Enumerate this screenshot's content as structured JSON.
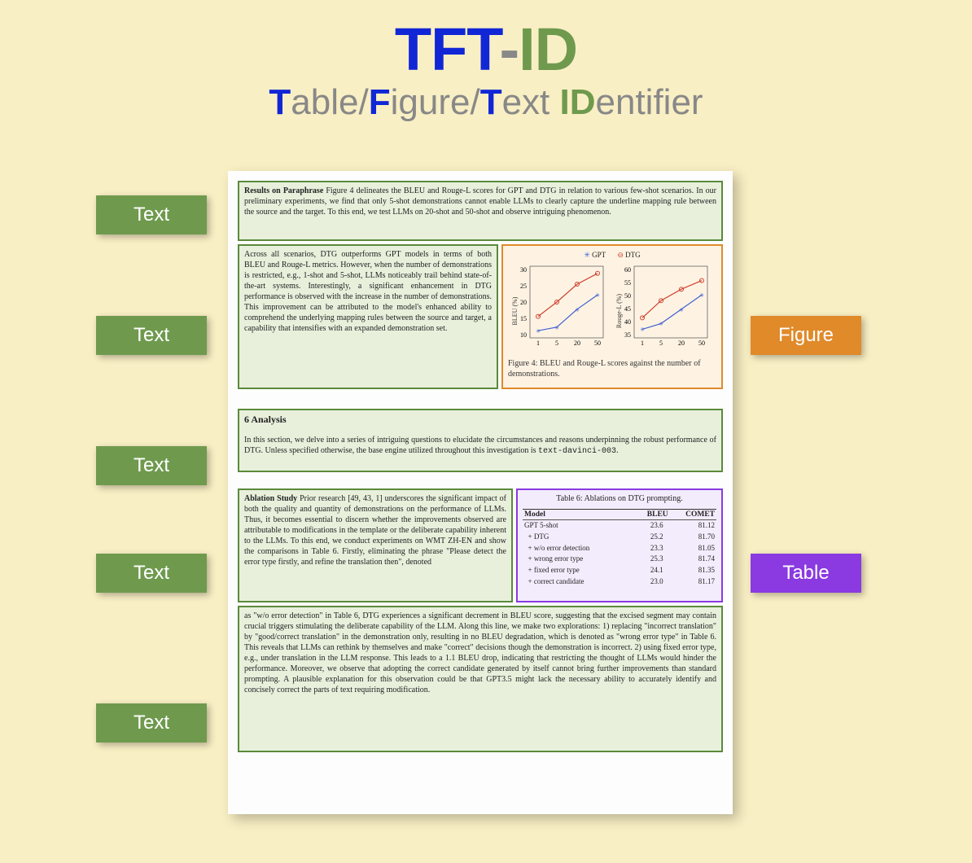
{
  "title": {
    "part1": "TFT",
    "dash": "-",
    "part2": "ID",
    "subtitle_T": "T",
    "subtitle_able": "able",
    "slash": "/",
    "subtitle_F": "F",
    "subtitle_igure": "igure",
    "subtitle_T2": "T",
    "subtitle_ext": "ext ",
    "subtitle_ID": "ID",
    "subtitle_entifier": "entifier"
  },
  "labels": {
    "text": "Text",
    "figure": "Figure",
    "table": "Table"
  },
  "regions": {
    "r1": {
      "bold": "Results on Paraphrase",
      "body": "   Figure 4 delineates the BLEU and Rouge-L scores for GPT and DTG in relation to various few-shot scenarios. In our preliminary experiments, we find that only 5-shot demonstrations cannot enable LLMs to clearly capture the underline mapping rule between the source and the target. To this end, we test LLMs on 20-shot and 50-shot and observe intriguing phenomenon."
    },
    "r2": {
      "body": "Across all scenarios, DTG outperforms GPT models in terms of both BLEU and Rouge-L metrics. However, when the number of demonstrations is restricted, e.g., 1-shot and 5-shot, LLMs noticeably trail behind state-of-the-art systems. Interestingly, a significant enhancement in DTG performance is observed with the increase in the number of demonstrations. This improvement can be attributed to the model's enhanced ability to comprehend the underlying mapping rules between the source and target, a capability that intensifies with an expanded demonstration set."
    },
    "fig": {
      "caption": "Figure 4: BLEU and Rouge-L scores against the number of demonstrations.",
      "legend_gpt": "GPT",
      "legend_dtg": "DTG",
      "chart1_ylabel": "BLEU (%)",
      "chart2_ylabel": "Rouge-L (%)"
    },
    "r3": {
      "heading": "6   Analysis",
      "body": "In this section, we delve into a series of intriguing questions to elucidate the circumstances and reasons underpinning the robust performance of DTG. Unless specified otherwise, the base engine utilized throughout this investigation is ",
      "code": "text-davinci-003",
      "period": "."
    },
    "r4": {
      "bold": "Ablation Study",
      "body": "   Prior research [49, 43, 1] underscores the significant impact of both the quality and quantity of demonstrations on the performance of LLMs. Thus, it becomes essential to discern whether the improvements observed are attributable to modifications in the template or the deliberate capability inherent to the LLMs. To this end, we conduct experiments on WMT ZH-EN and show the comparisons in Table 6. Firstly, eliminating the phrase \"Please detect the error type firstly, and refine the translation then\", denoted"
    },
    "tbl": {
      "caption": "Table 6: Ablations on DTG prompting.",
      "h_model": "Model",
      "h_bleu": "BLEU",
      "h_comet": "COMET"
    },
    "r5": {
      "body": "as \"w/o error detection\" in Table 6, DTG experiences a significant decrement in BLEU score, suggesting that the excised segment may contain crucial triggers stimulating the deliberate capability of the LLM. Along this line, we make two explorations: 1) replacing \"incorrect translation\" by \"good/correct translation\" in the demonstration only, resulting in no BLEU degradation, which is denoted as \"wrong error type\" in Table 6. This reveals that LLMs can rethink by themselves and make \"correct\" decisions though the demonstration is incorrect. 2) using fixed error type, e.g., under translation in the LLM response. This leads to a 1.1 BLEU drop, indicating that restricting the thought of LLMs would hinder the performance. Moreover, we observe that adopting the correct candidate generated by itself cannot bring further improvements than standard prompting. A plausible explanation for this observation could be that GPT3.5 might lack the necessary ability to accurately identify and concisely correct the parts of text requiring modification."
    }
  },
  "chart_data": [
    {
      "type": "line",
      "title": "BLEU vs demonstrations",
      "xlabel": "",
      "ylabel": "BLEU (%)",
      "x": [
        1,
        5,
        20,
        50
      ],
      "ylim": [
        10,
        30
      ],
      "series": [
        {
          "name": "GPT",
          "values": [
            12,
            13,
            18,
            22
          ]
        },
        {
          "name": "DTG",
          "values": [
            16,
            20,
            25,
            28
          ]
        }
      ]
    },
    {
      "type": "line",
      "title": "Rouge-L vs demonstrations",
      "xlabel": "",
      "ylabel": "Rouge-L (%)",
      "x": [
        1,
        5,
        20,
        50
      ],
      "ylim": [
        35,
        60
      ],
      "series": [
        {
          "name": "GPT",
          "values": [
            38,
            40,
            45,
            50
          ]
        },
        {
          "name": "DTG",
          "values": [
            42,
            48,
            52,
            55
          ]
        }
      ]
    }
  ],
  "table_data": {
    "columns": [
      "Model",
      "BLEU",
      "COMET"
    ],
    "rows": [
      [
        "GPT 5-shot",
        "23.6",
        "81.12"
      ],
      [
        "  + DTG",
        "25.2",
        "81.70"
      ],
      [
        "  + w/o error detection",
        "23.3",
        "81.05"
      ],
      [
        "  + wrong error type",
        "25.3",
        "81.74"
      ],
      [
        "  + fixed error type",
        "24.1",
        "81.35"
      ],
      [
        "  + correct candidate",
        "23.0",
        "81.17"
      ]
    ]
  }
}
